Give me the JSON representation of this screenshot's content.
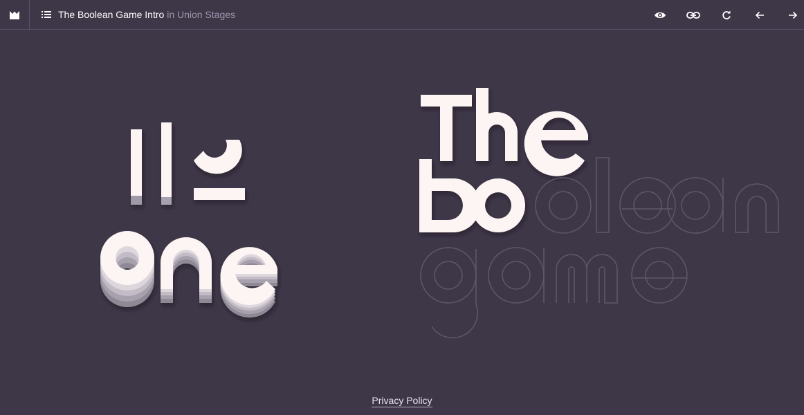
{
  "header": {
    "logo_icon": "union-logo-icon",
    "list_icon": "list-icon",
    "title": "The Boolean Game Intro",
    "separator": "in",
    "project": "Union Stages",
    "actions": [
      {
        "icon": "eye-icon"
      },
      {
        "icon": "link-icon"
      },
      {
        "icon": "refresh-icon"
      },
      {
        "icon": "arrow-left-icon"
      },
      {
        "icon": "arrow-right-icon"
      }
    ]
  },
  "stage": {
    "left_word": "one",
    "title_words": [
      "The",
      "bo",
      "olean",
      "game"
    ]
  },
  "footer": {
    "privacy_label": "Privacy Policy"
  },
  "colors": {
    "background": "#3d3748",
    "letter_fill": "#fdf4f4",
    "outline": "#5e586b",
    "border": "#57506a"
  }
}
